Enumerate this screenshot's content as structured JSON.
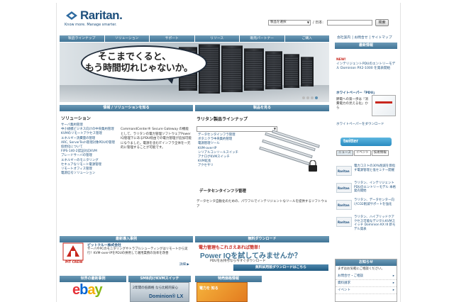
{
  "header": {
    "logo_text": "Raritan.",
    "tagline": "Know more. Manage smarter.",
    "search_select": "製品を選択",
    "lang_label": "/ 日本:",
    "search_button": "検索",
    "utility": [
      "会社案内",
      "お問合せ",
      "サイトマップ"
    ]
  },
  "nav": [
    "製品ラインナップ",
    "ソリューション",
    "サポート",
    "リソース",
    "販売パートナー",
    "ご購入"
  ],
  "hero": {
    "line1": "そこまでくると、",
    "line2": "もう時間切れじゃないか。",
    "dots": 4,
    "active_dot": 3
  },
  "sidebar": {
    "latest_head": "最新情報",
    "news_new": "NEW!",
    "news_text": "インテリジェントPDUのエントリーモデル Dominion PX2-1000 を発表開始",
    "wp_head": "ホワイトペーパー「PDU」",
    "wp_text": "節電への第一歩は『消費電力の見える化』から",
    "wp_link": "ホワイトペーパーをダウンロード",
    "twitter": "twitter",
    "sub_tabs": [
      "ニュース",
      "イベント",
      "技術情報"
    ],
    "tweets": [
      "電力コストの30%削減を目指す電源管理と低セミナー開催",
      "ラリタン、インテリジェントPDUのエントリーモデル 本格発売開始",
      "ラリタン、データセンター向けCO2削減サポートを強化",
      "ラリタン、ハイブリッドクアクセス可能なデジタルKVMスイッチ Dominion KX III 新モデル発表"
    ],
    "info_head": "お知らせ",
    "info_text": "まずはお気軽にご相談ください。",
    "info_items": [
      "お問合せ・ご相談",
      "資料請求",
      "イベント"
    ]
  },
  "main": {
    "solutions_head": "情報 / ソリューションを知る",
    "solutions_title": "ソリューション",
    "solution_links": [
      "サーバ集約管理",
      "中小規模ビジネス向けの中央集約管理",
      "KVMのリモートアクセス管理",
      "エネルギー消費量の管理",
      "ARC, ServerTech管理対象PDUの管理",
      "仮想化について",
      "FIPS-140-2認証対応KVM",
      "ブレードサーバの管理",
      "エネルギーのモニタリング",
      "セキュアなリモート電源管理",
      "リモートオフィス管理",
      "電源信号ソリューション"
    ],
    "solutions_body": "CommandCenter® Secure Gateway の機能として、ラリタンの電力管理ソフトウェアPower IQ管理下にあるPDU経由での電力管理が追加可能になりました。電源を含むITインフラ全体を一元的に管理することが可能です。",
    "products_head": "製品を見る",
    "products_title": "ラリタン製品ラインナップ",
    "product_links": [
      "データセンタインフラ管理",
      "ボタニクラ中央集約管理",
      "電源管理ツール",
      "KVM-over-IP",
      "シリアルコンソールスイッチ",
      "アナログKVMスイッチ",
      "KVM延長",
      "アクセサリ"
    ],
    "dcim_title": "データセンタインフラ管理",
    "dcim_body": "データセンタ自動化のための、パワフルでインテリジェントなツールを提供するソフトウェア",
    "case_head": "最新導入事例",
    "pitcrew_logo": "PIT CREW",
    "pitcrew_title": "ピットクルー株式会社",
    "pitcrew_body": "サーバやPCのモニタリングやトラブルシューティングはリモートから実行！KVM-over-IPをPDUの併用して運用業務の効率を改善",
    "detail_link": "詳細 ▶",
    "download_head": "無料ダウンロード",
    "dl_head": "電力管理もこれさえあれば簡単！",
    "dl_big": "Power IQを試してみませんか？",
    "dl_sub": "PDUをお持ちなら今すぐダウンロード",
    "dl_button": "無料試用版ダウンロードはこちら",
    "world_head": "世界の最新事例",
    "smb_head": "SMB向けKVMスイッチ",
    "event_head": "特売価格情報",
    "smb_img_text": "2年間の低価格 なら比較的安心",
    "dominion": "Dominion® LX",
    "event_img_text": "電力を 知る"
  },
  "colors": {
    "nav_blue": "#3f7395",
    "link_blue": "#1d4f7c",
    "accent_red": "#c8271e"
  }
}
